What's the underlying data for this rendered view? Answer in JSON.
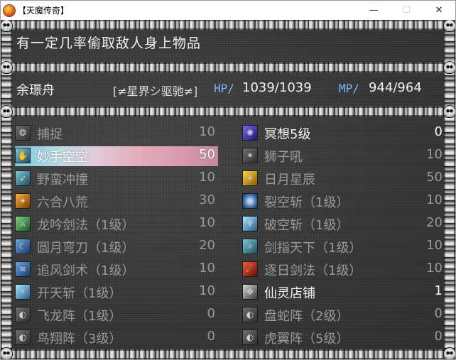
{
  "window": {
    "title": "【天魔传奇】",
    "minimize_glyph": "—",
    "maximize_glyph": "☐",
    "close_glyph": "✕"
  },
  "description": "有一定几率偷取敌人身上物品",
  "character": {
    "name": "余璟舟",
    "guild": "[≠星界シ驱驰≠]",
    "hp_label": "HP/",
    "hp_value": "1039/1039",
    "mp_label": "MP/",
    "mp_value": "944/964"
  },
  "skills_left": [
    {
      "name": "捕捉",
      "level": "10",
      "icon": "capture-icon",
      "glyph": "❂"
    },
    {
      "name": "妙手空空",
      "level": "50",
      "icon": "steal-icon",
      "glyph": "✋"
    },
    {
      "name": "野蛮冲撞",
      "level": "10",
      "icon": "charge-icon",
      "glyph": "➶"
    },
    {
      "name": "六合八荒",
      "level": "30",
      "icon": "six-directions-icon",
      "glyph": "✦"
    },
    {
      "name": "龙吟剑法（1级）",
      "level": "10",
      "icon": "dragon-sword-icon",
      "glyph": "⚔"
    },
    {
      "name": "圆月弯刀（1级）",
      "level": "20",
      "icon": "crescent-blade-icon",
      "glyph": "☾"
    },
    {
      "name": "追风剑术（1级）",
      "level": "10",
      "icon": "wind-sword-icon",
      "glyph": "≋"
    },
    {
      "name": "开天斩（1级）",
      "level": "10",
      "icon": "sky-slash-icon",
      "glyph": "⚡"
    },
    {
      "name": "飞龙阵（1级）",
      "level": "0",
      "icon": "dragon-formation-icon",
      "glyph": "◐"
    },
    {
      "name": "鸟翔阵（3级）",
      "level": "0",
      "icon": "bird-formation-icon",
      "glyph": "◐"
    }
  ],
  "skills_right": [
    {
      "name": "冥想5级",
      "level": "0",
      "icon": "meditation-icon",
      "glyph": "✺"
    },
    {
      "name": "狮子吼",
      "level": "10",
      "icon": "lion-roar-icon",
      "glyph": "✶"
    },
    {
      "name": "日月星辰",
      "level": "50",
      "icon": "sun-moon-icon",
      "glyph": "☀"
    },
    {
      "name": "裂空斩（1级）",
      "level": "10",
      "icon": "void-slash-icon",
      "glyph": "◎"
    },
    {
      "name": "破空斩（1级）",
      "level": "20",
      "icon": "break-sky-icon",
      "glyph": "♆"
    },
    {
      "name": "剑指天下（1级）",
      "level": "10",
      "icon": "sword-point-icon",
      "glyph": "✧"
    },
    {
      "name": "逐日剑法（1级）",
      "level": "10",
      "icon": "sun-chase-icon",
      "glyph": "☄"
    },
    {
      "name": "仙灵店铺",
      "level": "1",
      "icon": "shop-icon",
      "glyph": "❖"
    },
    {
      "name": "盘蛇阵（2级）",
      "level": "0",
      "icon": "snake-formation-icon",
      "glyph": "◐"
    },
    {
      "name": "虎翼阵（5级）",
      "level": "0",
      "icon": "tiger-formation-icon",
      "glyph": "◐"
    }
  ],
  "colors": {
    "dim_text": "#9a9a9a",
    "bright_text": "#f2f2f2",
    "hp_mp_label": "#7fb3ff"
  }
}
